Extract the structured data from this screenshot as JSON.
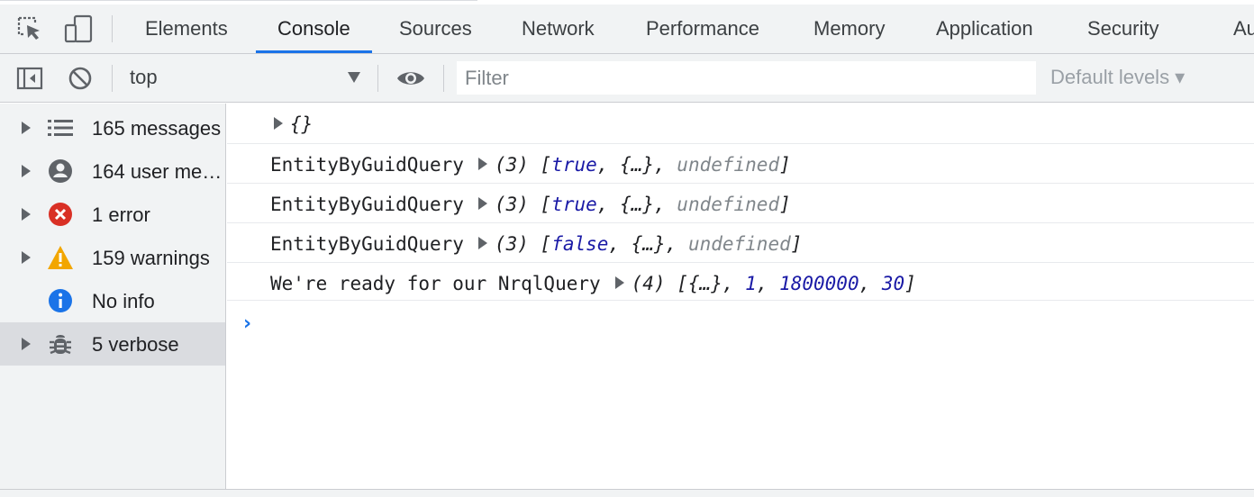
{
  "tabs": [
    {
      "label": "Elements"
    },
    {
      "label": "Console",
      "active": true
    },
    {
      "label": "Sources"
    },
    {
      "label": "Network"
    },
    {
      "label": "Performance"
    },
    {
      "label": "Memory"
    },
    {
      "label": "Application"
    },
    {
      "label": "Security"
    },
    {
      "label": "Audit"
    }
  ],
  "toolbar": {
    "context": "top",
    "filter_placeholder": "Filter",
    "filter_value": "",
    "levels": "Default levels ▾"
  },
  "sidebar": {
    "items": [
      {
        "label": "165 messages",
        "icon": "list-icon"
      },
      {
        "label": "164 user messages",
        "icon": "user-icon"
      },
      {
        "label": "1 error",
        "icon": "error-icon"
      },
      {
        "label": "159 warnings",
        "icon": "warning-icon"
      },
      {
        "label": "No info",
        "icon": "info-icon"
      },
      {
        "label": "5 verbose",
        "icon": "bug-icon",
        "selected": true
      }
    ]
  },
  "console": {
    "rows": [
      {
        "tokens": [
          "{}"
        ]
      },
      {
        "prefix": "EntityByGuidQuery",
        "count": "(3)",
        "tokens": [
          "[",
          "true",
          ", ",
          "{…}",
          ", ",
          "undefined",
          "]"
        ]
      },
      {
        "prefix": "EntityByGuidQuery",
        "count": "(3)",
        "tokens": [
          "[",
          "true",
          ", ",
          "{…}",
          ", ",
          "undefined",
          "]"
        ]
      },
      {
        "prefix": "EntityByGuidQuery",
        "count": "(3)",
        "tokens": [
          "[",
          "false",
          ", ",
          "{…}",
          ", ",
          "undefined",
          "]"
        ]
      },
      {
        "prefix": "We're ready for our NrqlQuery",
        "count": "(4)",
        "tokens": [
          "[",
          "{…}",
          ", ",
          "1",
          ", ",
          "1800000",
          ", ",
          "30",
          "]"
        ]
      }
    ],
    "prompt": "›"
  },
  "colors": {
    "accent": "#1a73e8",
    "value_blue": "#1a1aa6",
    "error_red": "#d93025",
    "warning_yellow": "#f2a600",
    "info_blue": "#1a73e8"
  }
}
